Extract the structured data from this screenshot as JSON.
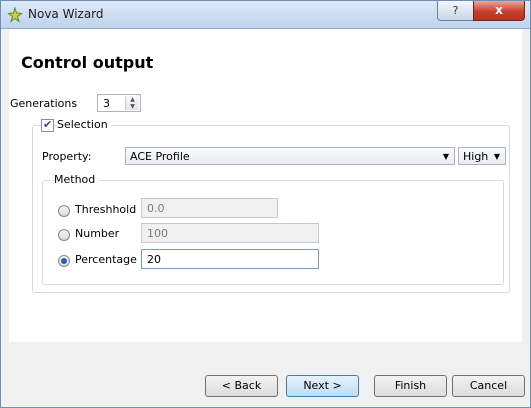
{
  "window": {
    "title": "Nova Wizard",
    "help_label": "?",
    "close_label": "x"
  },
  "page": {
    "heading": "Control output"
  },
  "generations": {
    "label": "Generations",
    "value": "3"
  },
  "selection": {
    "label": "Selection",
    "checked": true,
    "property_label": "Property:",
    "property_value": "ACE Profile",
    "level_value": "High"
  },
  "method": {
    "label": "Method",
    "options": [
      {
        "label": "Threshhold",
        "value": "0.0",
        "selected": false
      },
      {
        "label": "Number",
        "value": "100",
        "selected": false
      },
      {
        "label": "Percentage",
        "value": "20",
        "selected": true
      }
    ]
  },
  "buttons": {
    "back": "< Back",
    "next": "Next >",
    "finish": "Finish",
    "cancel": "Cancel"
  },
  "colors": {
    "title_bg": "#c9daf0",
    "close": "#c6402d",
    "accent": "#1f5fbf"
  }
}
